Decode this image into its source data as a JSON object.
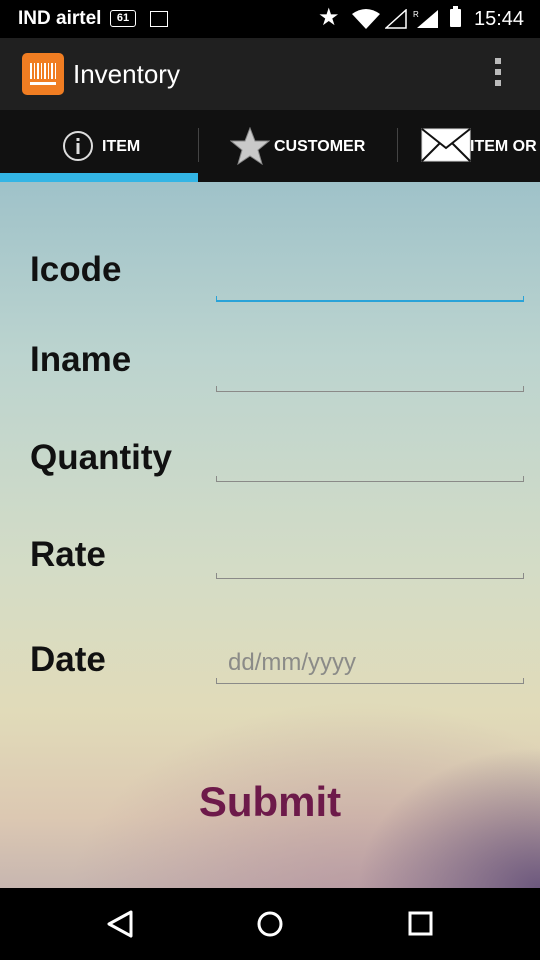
{
  "status_bar": {
    "carrier": "IND airtel",
    "badge": "61",
    "time": "15:44",
    "icons": [
      "notification-badge-icon",
      "image-icon",
      "star-icon",
      "wifi-icon",
      "signal-icon",
      "roaming-signal-icon",
      "battery-icon"
    ]
  },
  "action_bar": {
    "title": "Inventory",
    "app_icon": "barcode-icon",
    "overflow_icon": "overflow-menu-icon"
  },
  "tabs": [
    {
      "label": "ITEM",
      "icon": "info-icon",
      "selected": true
    },
    {
      "label": "CUSTOMER",
      "icon": "star-icon",
      "selected": false
    },
    {
      "label": "ITEM OR",
      "icon": "mail-icon",
      "selected": false
    }
  ],
  "form": {
    "fields": [
      {
        "label": "Icode",
        "value": "",
        "placeholder": ""
      },
      {
        "label": "Iname",
        "value": "",
        "placeholder": ""
      },
      {
        "label": "Quantity",
        "value": "",
        "placeholder": ""
      },
      {
        "label": "Rate",
        "value": "",
        "placeholder": ""
      },
      {
        "label": "Date",
        "value": "",
        "placeholder": "dd/mm/yyyy"
      }
    ],
    "submit_label": "Submit"
  },
  "colors": {
    "accent": "#33b5e5",
    "submit_text": "#6d1a4a",
    "app_icon_bg": "#f07d22"
  },
  "nav_bar": {
    "icons": [
      "back-icon",
      "home-icon",
      "recents-icon"
    ]
  }
}
